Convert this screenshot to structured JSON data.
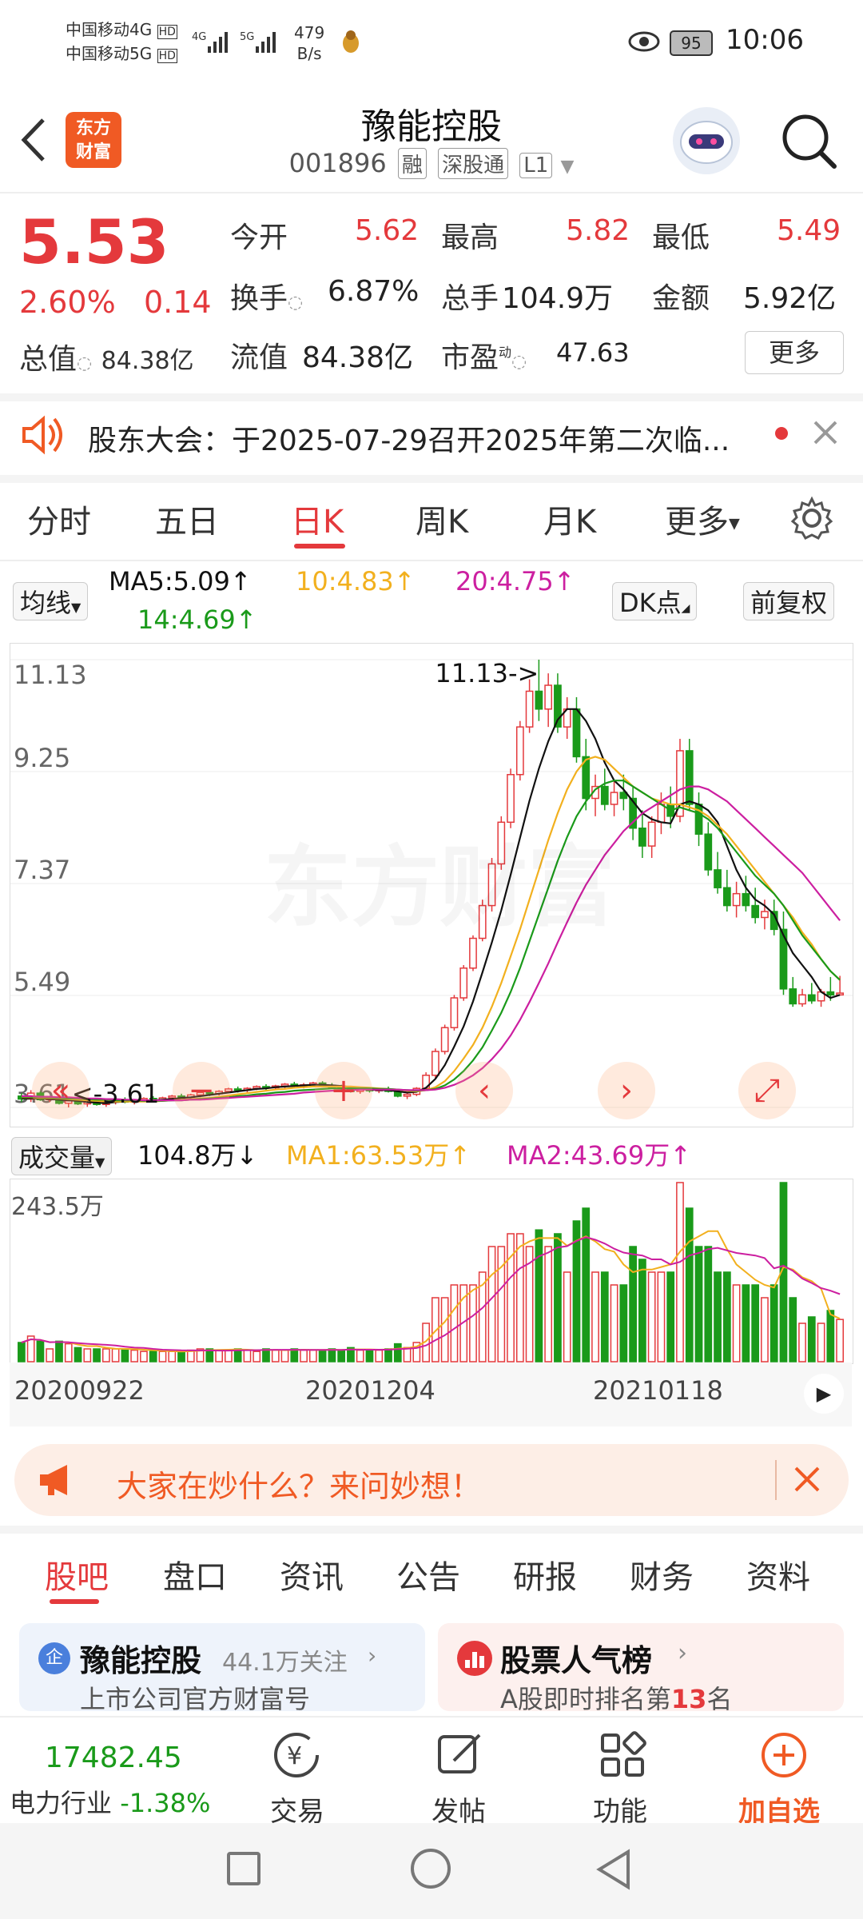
{
  "status": {
    "carrier1": "中国移动4G",
    "carrier2": "中国移动5G",
    "hd": "HD",
    "net1": "4G",
    "net2": "5G",
    "speed_num": "479",
    "speed_unit": "B/s",
    "battery": "95",
    "time": "10:06"
  },
  "header": {
    "logo_line1": "东方",
    "logo_line2": "财富",
    "title": "豫能控股",
    "code": "001896",
    "tags": [
      "融",
      "深股通",
      "L1"
    ]
  },
  "quote": {
    "price": "5.53",
    "change_pct": "2.60%",
    "change": "0.14",
    "total_value_label": "总值",
    "total_value": "84.38亿",
    "open_label": "今开",
    "open": "5.62",
    "high_label": "最高",
    "high": "5.82",
    "low_label": "最低",
    "low": "5.49",
    "turnover_label": "换手",
    "turnover": "6.87%",
    "volume_label": "总手",
    "volume": "104.9万",
    "amount_label": "金额",
    "amount": "5.92亿",
    "float_label": "流值",
    "float_value": "84.38亿",
    "pe_label": "市盈",
    "pe_sup": "动",
    "pe": "47.63",
    "more": "更多"
  },
  "notice": {
    "text": "股东大会：于2025-07-29召开2025年第二次临..."
  },
  "tabs": [
    "分时",
    "五日",
    "日K",
    "周K",
    "月K",
    "更多"
  ],
  "tab_active": 2,
  "ma_bar": {
    "select": "均线",
    "ma5": "MA5:5.09",
    "ma10": "10:4.83",
    "ma20": "20:4.75",
    "ma14": "14:4.69",
    "dk": "DK点",
    "adjust": "前复权"
  },
  "colors": {
    "red": "#e4393c",
    "green": "#1a9a1a",
    "ma5": "#111111",
    "ma10": "#f2b01e",
    "ma20": "#cc1fa0",
    "ma14": "#1a9a1a"
  },
  "chart_data": {
    "type": "candlestick",
    "y_ticks": [
      "11.13",
      "9.25",
      "7.37",
      "5.49",
      "3.61"
    ],
    "ylim": [
      3.61,
      11.13
    ],
    "max_annotation": "11.13->",
    "min_annotation": "<-3.61",
    "x_ticks": [
      "20200922",
      "20201204",
      "20210118"
    ],
    "volume_label": "成交量",
    "volume": "104.8万",
    "vol_ma1": "MA1:63.53万",
    "vol_ma2": "MA2:43.69万",
    "vol_max": "243.5万",
    "candles": [
      [
        3.8,
        3.85,
        3.7,
        3.75
      ],
      [
        3.75,
        3.9,
        3.7,
        3.85
      ],
      [
        3.85,
        3.88,
        3.72,
        3.74
      ],
      [
        3.74,
        3.8,
        3.7,
        3.78
      ],
      [
        3.78,
        3.82,
        3.66,
        3.68
      ],
      [
        3.68,
        3.75,
        3.61,
        3.72
      ],
      [
        3.72,
        3.76,
        3.65,
        3.67
      ],
      [
        3.67,
        3.72,
        3.62,
        3.7
      ],
      [
        3.7,
        3.74,
        3.64,
        3.66
      ],
      [
        3.66,
        3.72,
        3.62,
        3.7
      ],
      [
        3.7,
        3.76,
        3.66,
        3.74
      ],
      [
        3.74,
        3.78,
        3.68,
        3.7
      ],
      [
        3.7,
        3.75,
        3.66,
        3.73
      ],
      [
        3.73,
        3.78,
        3.7,
        3.76
      ],
      [
        3.76,
        3.8,
        3.72,
        3.74
      ],
      [
        3.74,
        3.79,
        3.71,
        3.77
      ],
      [
        3.77,
        3.82,
        3.74,
        3.8
      ],
      [
        3.8,
        3.84,
        3.76,
        3.78
      ],
      [
        3.78,
        3.84,
        3.75,
        3.82
      ],
      [
        3.82,
        3.88,
        3.78,
        3.86
      ],
      [
        3.86,
        3.9,
        3.8,
        3.84
      ],
      [
        3.84,
        3.9,
        3.81,
        3.88
      ],
      [
        3.88,
        3.94,
        3.85,
        3.92
      ],
      [
        3.92,
        3.96,
        3.86,
        3.9
      ],
      [
        3.9,
        3.95,
        3.86,
        3.93
      ],
      [
        3.93,
        3.98,
        3.9,
        3.96
      ],
      [
        3.96,
        4.0,
        3.9,
        3.94
      ],
      [
        3.94,
        3.99,
        3.9,
        3.97
      ],
      [
        3.97,
        4.02,
        3.93,
        4.0
      ],
      [
        4.0,
        4.04,
        3.94,
        3.97
      ],
      [
        3.97,
        4.02,
        3.93,
        3.99
      ],
      [
        3.99,
        4.04,
        3.95,
        4.02
      ],
      [
        4.02,
        4.05,
        3.96,
        3.98
      ],
      [
        3.98,
        4.02,
        3.92,
        3.95
      ],
      [
        3.95,
        3.99,
        3.9,
        3.93
      ],
      [
        3.93,
        3.97,
        3.86,
        3.88
      ],
      [
        3.88,
        3.93,
        3.84,
        3.91
      ],
      [
        3.91,
        3.95,
        3.86,
        3.89
      ],
      [
        3.89,
        3.94,
        3.85,
        3.92
      ],
      [
        3.92,
        3.96,
        3.86,
        3.88
      ],
      [
        3.88,
        3.92,
        3.78,
        3.8
      ],
      [
        3.8,
        3.86,
        3.75,
        3.83
      ],
      [
        3.83,
        3.95,
        3.8,
        3.93
      ],
      [
        3.93,
        4.2,
        3.9,
        4.15
      ],
      [
        4.15,
        4.6,
        4.1,
        4.55
      ],
      [
        4.55,
        5.0,
        4.5,
        4.95
      ],
      [
        4.95,
        5.5,
        4.9,
        5.45
      ],
      [
        5.45,
        6.0,
        5.4,
        5.95
      ],
      [
        5.95,
        6.5,
        5.9,
        6.45
      ],
      [
        6.45,
        7.1,
        6.4,
        7.0
      ],
      [
        7.0,
        7.8,
        6.9,
        7.7
      ],
      [
        7.7,
        8.5,
        7.6,
        8.4
      ],
      [
        8.4,
        9.3,
        8.3,
        9.2
      ],
      [
        9.2,
        10.1,
        9.1,
        10.0
      ],
      [
        10.0,
        10.8,
        9.9,
        10.6
      ],
      [
        10.6,
        11.13,
        10.1,
        10.3
      ],
      [
        10.3,
        10.9,
        10.0,
        10.7
      ],
      [
        10.7,
        10.9,
        9.9,
        10.0
      ],
      [
        10.0,
        10.5,
        9.8,
        10.3
      ],
      [
        10.3,
        10.5,
        9.4,
        9.5
      ],
      [
        9.5,
        9.8,
        8.6,
        8.8
      ],
      [
        8.8,
        9.2,
        8.5,
        9.0
      ],
      [
        9.0,
        9.3,
        8.6,
        8.7
      ],
      [
        8.7,
        9.1,
        8.5,
        8.9
      ],
      [
        8.9,
        9.2,
        8.6,
        8.8
      ],
      [
        8.8,
        9.0,
        8.1,
        8.3
      ],
      [
        8.3,
        8.6,
        7.8,
        8.0
      ],
      [
        8.0,
        8.5,
        7.8,
        8.4
      ],
      [
        8.4,
        8.9,
        8.2,
        8.7
      ],
      [
        8.7,
        9.0,
        8.3,
        8.5
      ],
      [
        8.5,
        9.8,
        8.4,
        9.6
      ],
      [
        9.6,
        9.8,
        8.6,
        8.7
      ],
      [
        8.7,
        8.9,
        8.0,
        8.2
      ],
      [
        8.2,
        8.4,
        7.5,
        7.6
      ],
      [
        7.6,
        7.9,
        7.2,
        7.3
      ],
      [
        7.3,
        7.6,
        6.9,
        7.0
      ],
      [
        7.0,
        7.4,
        6.8,
        7.2
      ],
      [
        7.2,
        7.5,
        6.9,
        7.0
      ],
      [
        7.0,
        7.3,
        6.7,
        6.8
      ],
      [
        6.8,
        7.1,
        6.6,
        6.9
      ],
      [
        6.9,
        7.1,
        6.5,
        6.6
      ],
      [
        6.6,
        6.9,
        5.5,
        5.6
      ],
      [
        5.6,
        5.8,
        5.3,
        5.35
      ],
      [
        5.35,
        5.6,
        5.3,
        5.5
      ],
      [
        5.5,
        5.7,
        5.35,
        5.4
      ],
      [
        5.4,
        5.6,
        5.3,
        5.55
      ],
      [
        5.55,
        5.8,
        5.4,
        5.5
      ],
      [
        5.5,
        5.82,
        5.49,
        5.53
      ]
    ],
    "ma5": [
      3.76,
      3.76,
      3.76,
      3.75,
      3.74,
      3.73,
      3.72,
      3.7,
      3.69,
      3.68,
      3.7,
      3.71,
      3.72,
      3.72,
      3.73,
      3.74,
      3.75,
      3.77,
      3.78,
      3.8,
      3.82,
      3.84,
      3.86,
      3.88,
      3.9,
      3.92,
      3.93,
      3.95,
      3.96,
      3.97,
      3.98,
      3.99,
      3.99,
      3.98,
      3.97,
      3.95,
      3.93,
      3.91,
      3.9,
      3.9,
      3.88,
      3.86,
      3.87,
      3.94,
      4.09,
      4.32,
      4.63,
      4.97,
      5.39,
      5.88,
      6.38,
      6.92,
      7.52,
      8.14,
      8.76,
      9.3,
      9.76,
      10.12,
      10.3,
      10.3,
      10.1,
      9.8,
      9.4,
      9.1,
      8.95,
      8.75,
      8.55,
      8.45,
      8.4,
      8.38,
      8.7,
      8.75,
      8.7,
      8.6,
      8.4,
      8.0,
      7.6,
      7.3,
      7.1,
      7.0,
      6.85,
      6.5,
      6.2,
      6.0,
      5.8,
      5.55,
      5.45,
      5.5
    ],
    "ma10": [
      3.78,
      3.78,
      3.77,
      3.77,
      3.76,
      3.75,
      3.74,
      3.73,
      3.72,
      3.71,
      3.71,
      3.71,
      3.71,
      3.71,
      3.71,
      3.72,
      3.73,
      3.74,
      3.75,
      3.76,
      3.77,
      3.79,
      3.81,
      3.83,
      3.85,
      3.87,
      3.89,
      3.91,
      3.92,
      3.94,
      3.95,
      3.96,
      3.96,
      3.96,
      3.96,
      3.96,
      3.95,
      3.94,
      3.93,
      3.92,
      3.91,
      3.89,
      3.88,
      3.9,
      3.95,
      4.05,
      4.22,
      4.43,
      4.66,
      4.95,
      5.3,
      5.7,
      6.15,
      6.6,
      7.1,
      7.6,
      8.1,
      8.55,
      8.95,
      9.25,
      9.45,
      9.5,
      9.45,
      9.3,
      9.15,
      9.0,
      8.9,
      8.8,
      8.75,
      8.7,
      8.7,
      8.65,
      8.6,
      8.5,
      8.35,
      8.2,
      8.0,
      7.8,
      7.6,
      7.4,
      7.2,
      7.0,
      6.8,
      6.55,
      6.35,
      6.1,
      5.9,
      5.75
    ],
    "ma20": [
      3.8,
      3.8,
      3.79,
      3.79,
      3.78,
      3.78,
      3.77,
      3.76,
      3.76,
      3.75,
      3.75,
      3.74,
      3.74,
      3.73,
      3.73,
      3.73,
      3.73,
      3.73,
      3.74,
      3.74,
      3.75,
      3.76,
      3.77,
      3.78,
      3.79,
      3.8,
      3.81,
      3.82,
      3.83,
      3.84,
      3.86,
      3.87,
      3.88,
      3.89,
      3.9,
      3.9,
      3.91,
      3.91,
      3.91,
      3.91,
      3.91,
      3.9,
      3.9,
      3.9,
      3.91,
      3.94,
      3.99,
      4.06,
      4.15,
      4.27,
      4.42,
      4.6,
      4.82,
      5.08,
      5.38,
      5.7,
      6.03,
      6.38,
      6.72,
      7.05,
      7.35,
      7.6,
      7.85,
      8.05,
      8.25,
      8.4,
      8.55,
      8.65,
      8.75,
      8.85,
      8.95,
      9.0,
      9.0,
      8.95,
      8.85,
      8.75,
      8.6,
      8.45,
      8.3,
      8.15,
      8.0,
      7.85,
      7.7,
      7.55,
      7.35,
      7.15,
      6.95,
      6.75
    ],
    "ma14": [
      3.79,
      3.79,
      3.78,
      3.78,
      3.77,
      3.76,
      3.76,
      3.75,
      3.74,
      3.74,
      3.73,
      3.73,
      3.73,
      3.72,
      3.72,
      3.72,
      3.73,
      3.73,
      3.74,
      3.75,
      3.76,
      3.77,
      3.78,
      3.8,
      3.81,
      3.83,
      3.84,
      3.86,
      3.87,
      3.89,
      3.9,
      3.91,
      3.92,
      3.93,
      3.93,
      3.93,
      3.93,
      3.93,
      3.92,
      3.92,
      3.91,
      3.9,
      3.89,
      3.9,
      3.92,
      3.98,
      4.08,
      4.22,
      4.4,
      4.62,
      4.9,
      5.2,
      5.55,
      5.95,
      6.4,
      6.85,
      7.3,
      7.75,
      8.15,
      8.5,
      8.75,
      8.95,
      9.05,
      9.1,
      9.1,
      9.0,
      8.9,
      8.8,
      8.7,
      8.6,
      8.65,
      8.6,
      8.55,
      8.45,
      8.3,
      8.1,
      7.9,
      7.7,
      7.5,
      7.35,
      7.2,
      7.0,
      6.75,
      6.5,
      6.3,
      6.1,
      5.9,
      5.75
    ]
  },
  "nav_icons": [
    "back-page-icon",
    "zoom-out-icon",
    "zoom-in-icon",
    "prev-icon",
    "next-icon",
    "fullscreen-icon"
  ],
  "banner": {
    "text": "大家在炒什么？来问妙想！"
  },
  "bottom_tabs": [
    "股吧",
    "盘口",
    "资讯",
    "公告",
    "研报",
    "财务",
    "资料"
  ],
  "cards": {
    "left_badge": "企",
    "left_title": "豫能控股",
    "left_follow": "44.1万关注",
    "left_sub": "上市公司官方财富号",
    "right_title": "股票人气榜",
    "right_sub_prefix": "A股即时排名第",
    "right_rank": "13",
    "right_sub_suffix": "名"
  },
  "bottom_bar": {
    "index_value": "17482.45",
    "industry": "电力行业",
    "industry_change": "-1.38%",
    "trade": "交易",
    "post": "发帖",
    "features": "功能",
    "add": "加自选"
  }
}
